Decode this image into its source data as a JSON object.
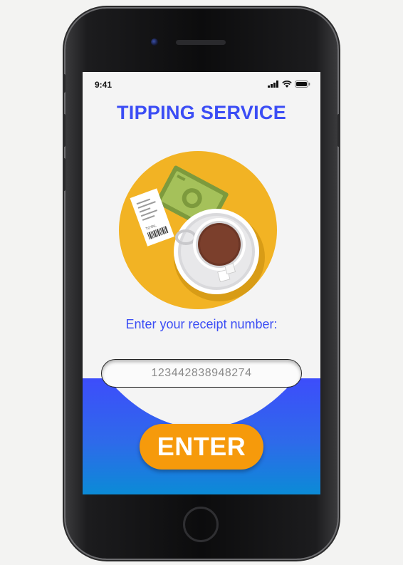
{
  "status_bar": {
    "time": "9:41",
    "icons": [
      "signal-icon",
      "wifi-icon",
      "battery-icon"
    ]
  },
  "header": {
    "title": "TIPPING SERVICE"
  },
  "illustration": {
    "icon": "coffee-and-tip-illustration",
    "receipt_text": "TOTAL"
  },
  "form": {
    "prompt": "Enter your receipt number:",
    "receipt_value": "123442838948274",
    "submit_label": "ENTER"
  },
  "colors": {
    "accent_blue": "#3b4df5",
    "button_orange": "#f69a0b",
    "circle_yellow": "#f2b324",
    "gradient_top": "#3d4dfb",
    "gradient_bottom": "#0b8bd6"
  }
}
